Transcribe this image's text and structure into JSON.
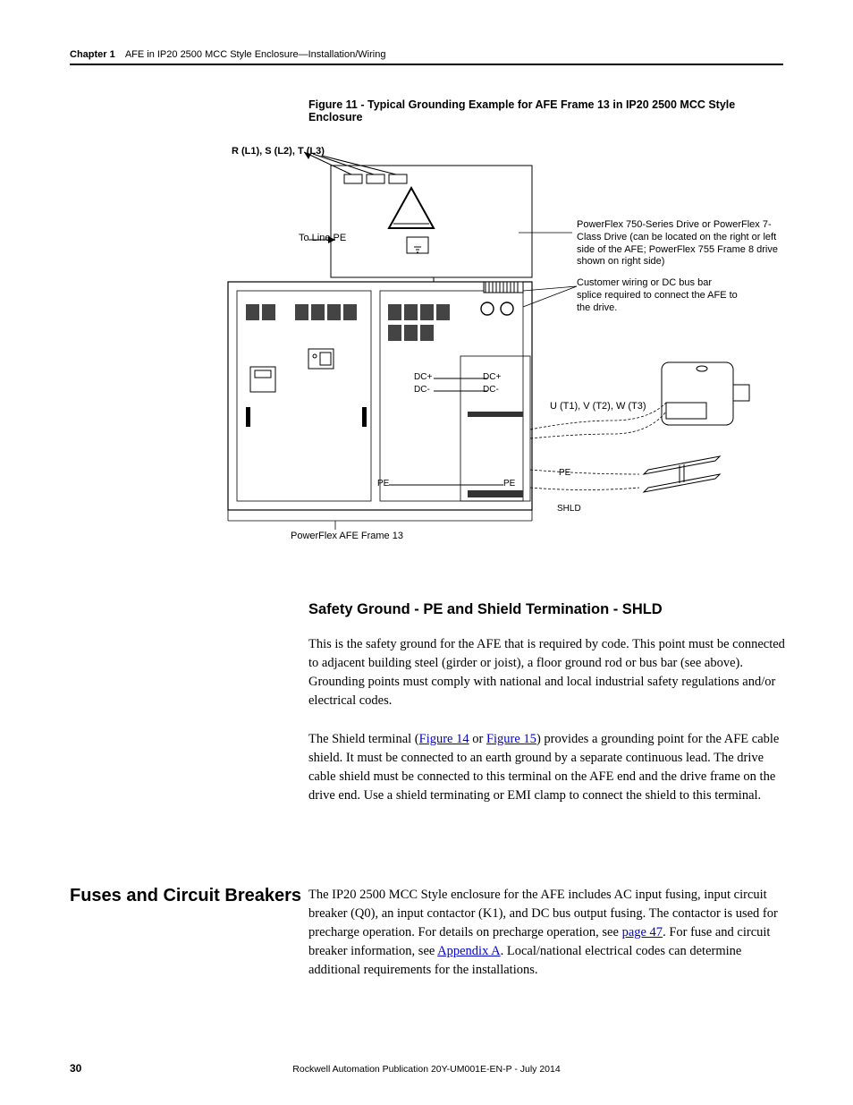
{
  "header": {
    "chapter": "Chapter 1",
    "title": "AFE in IP20 2500 MCC Style Enclosure—Installation/Wiring"
  },
  "figure": {
    "caption": "Figure 11 - Typical Grounding Example for AFE Frame 13 in IP20 2500 MCC Style Enclosure",
    "labels": {
      "top_terminals": "R (L1), S (L2), T (L3)",
      "line_pe": "To Line PE",
      "drive_note": "PowerFlex 750-Series Drive or PowerFlex 7-Class Drive (can be located on the right or left side of the AFE; PowerFlex 755 Frame 8 drive shown on right side)",
      "customer_wiring": "Customer wiring or DC bus bar splice required to connect the AFE to the drive.",
      "dc_plus": "DC+",
      "dc_minus": "DC-",
      "output_terminals": "U (T1), V (T2), W (T3)",
      "pe": "PE",
      "shld": "SHLD",
      "frame_caption": "PowerFlex AFE Frame 13"
    }
  },
  "section": {
    "heading1": "Safety Ground - PE and Shield Termination - SHLD",
    "para1": "This is the safety ground for the AFE that is required by code. This point must be connected to adjacent building steel (girder or joist), a floor ground rod or bus bar (see above). Grounding points must comply with national and local industrial safety regulations and/or electrical codes.",
    "para2_a": "The Shield terminal (",
    "link_fig14": "Figure 14",
    "para2_b": " or ",
    "link_fig15": "Figure 15",
    "para2_c": ") provides a grounding point for the AFE cable shield. It must be connected to an earth ground by a separate continuous lead. The drive cable shield must be connected to this terminal on the AFE end and the drive frame on the drive end. Use a shield terminating or EMI clamp to connect the shield to this terminal."
  },
  "section2": {
    "side_heading": "Fuses and Circuit Breakers",
    "para_a": "The IP20 2500 MCC Style enclosure for the AFE includes AC input fusing, input circuit breaker (Q0), an input contactor (K1), and DC bus output fusing. The contactor is used for precharge operation. For details on precharge operation, see ",
    "link_page47": "page 47",
    "para_b": ". For fuse and circuit breaker information, see ",
    "link_appendixA": "Appendix A",
    "para_c": ". Local/national electrical codes can determine additional requirements for the installations."
  },
  "footer": {
    "page": "30",
    "publication": "Rockwell Automation Publication 20Y-UM001E-EN-P - July 2014"
  }
}
